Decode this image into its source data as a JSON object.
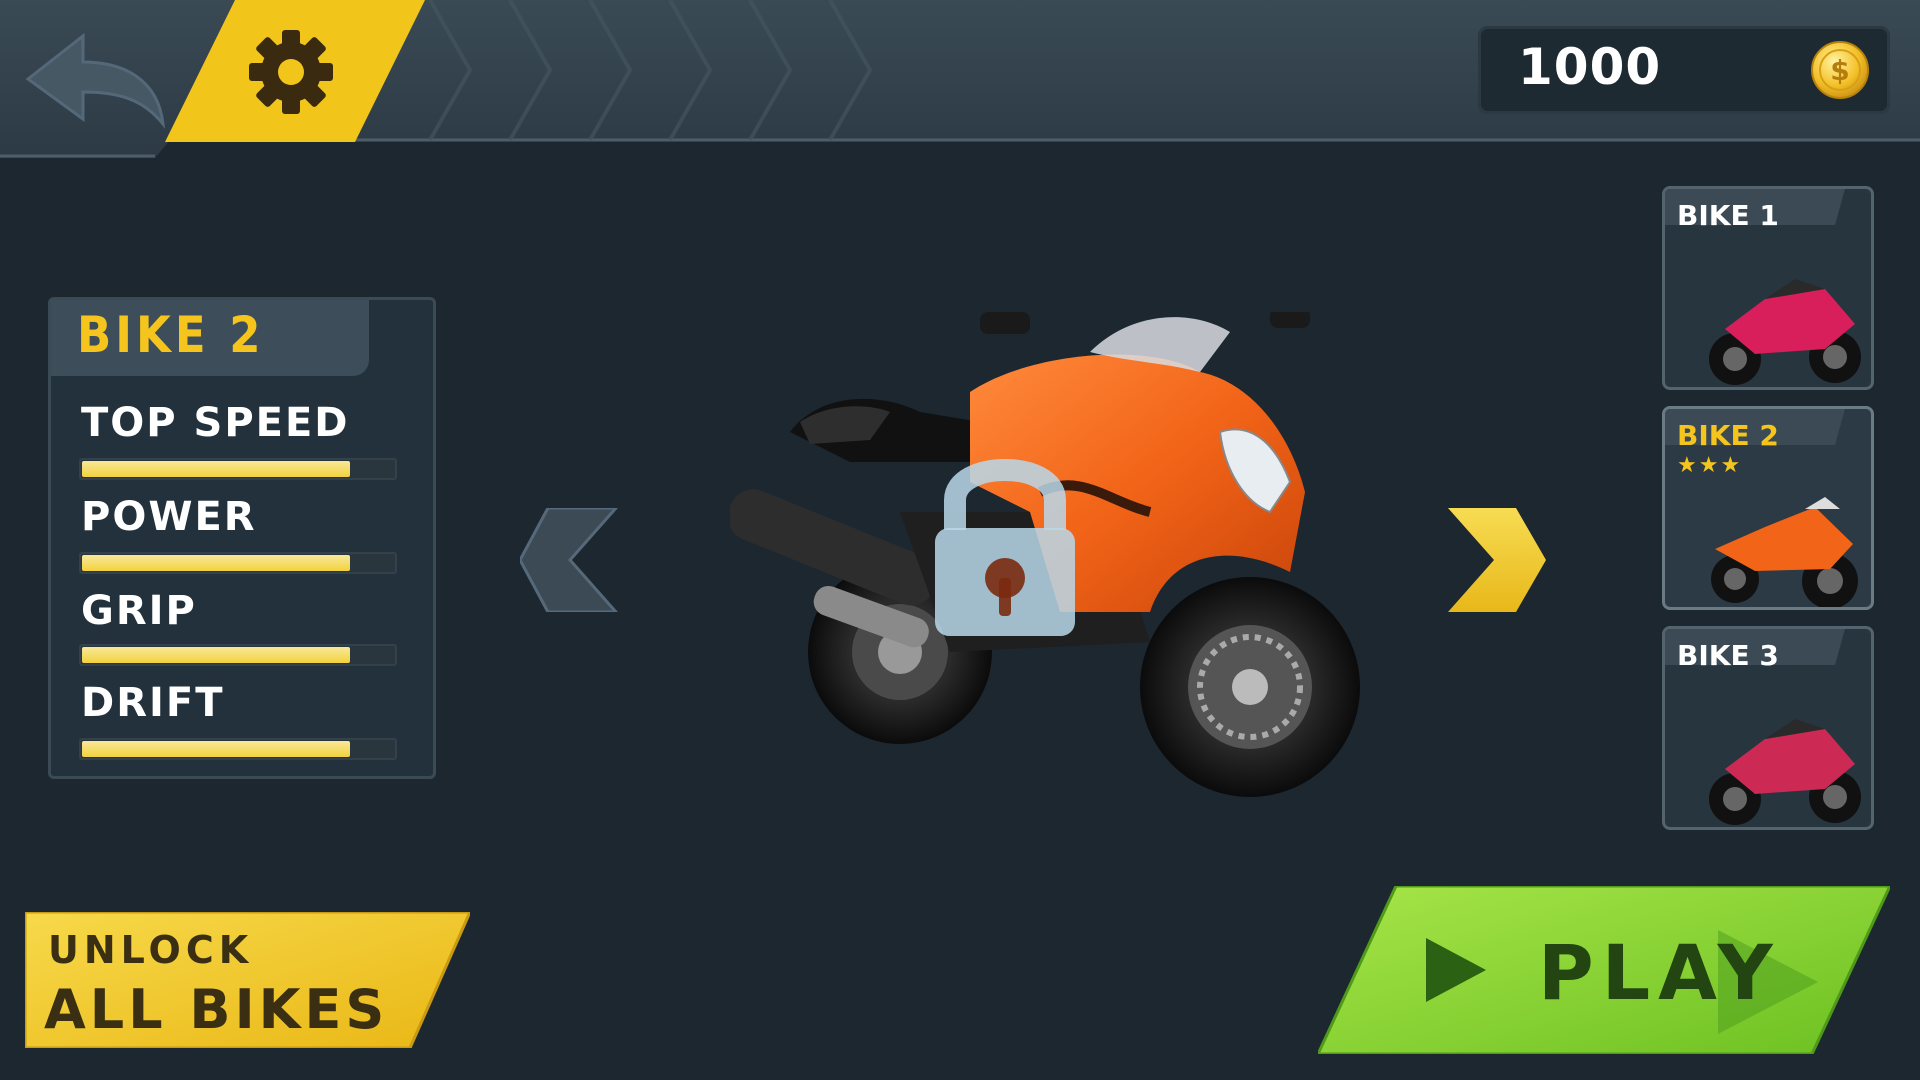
{
  "top_bar": {
    "back_icon": "back-arrow-icon",
    "settings_icon": "gear-icon",
    "coins": "1000",
    "coin_icon": "dollar-coin-icon"
  },
  "stats": {
    "title": "BIKE 2",
    "items": [
      {
        "label": "TOP SPEED",
        "value": 0.86
      },
      {
        "label": "POWER",
        "value": 0.86
      },
      {
        "label": "GRIP",
        "value": 0.86
      },
      {
        "label": "DRIFT",
        "value": 0.86
      }
    ]
  },
  "center": {
    "locked": true,
    "prev_icon": "chevron-left-icon",
    "next_icon": "chevron-right-icon"
  },
  "bike_list": [
    {
      "name": "BIKE 1",
      "selected": false,
      "stars": ""
    },
    {
      "name": "BIKE 2",
      "selected": true,
      "stars": "★★★"
    },
    {
      "name": "BIKE 3",
      "selected": false,
      "stars": ""
    }
  ],
  "actions": {
    "unlock_line1": "UNLOCK",
    "unlock_line2": "ALL BIKES",
    "play_label": "PLAY"
  },
  "colors": {
    "accent_yellow": "#f5c51d",
    "play_green": "#8fd63a",
    "background": "#1c2730"
  }
}
